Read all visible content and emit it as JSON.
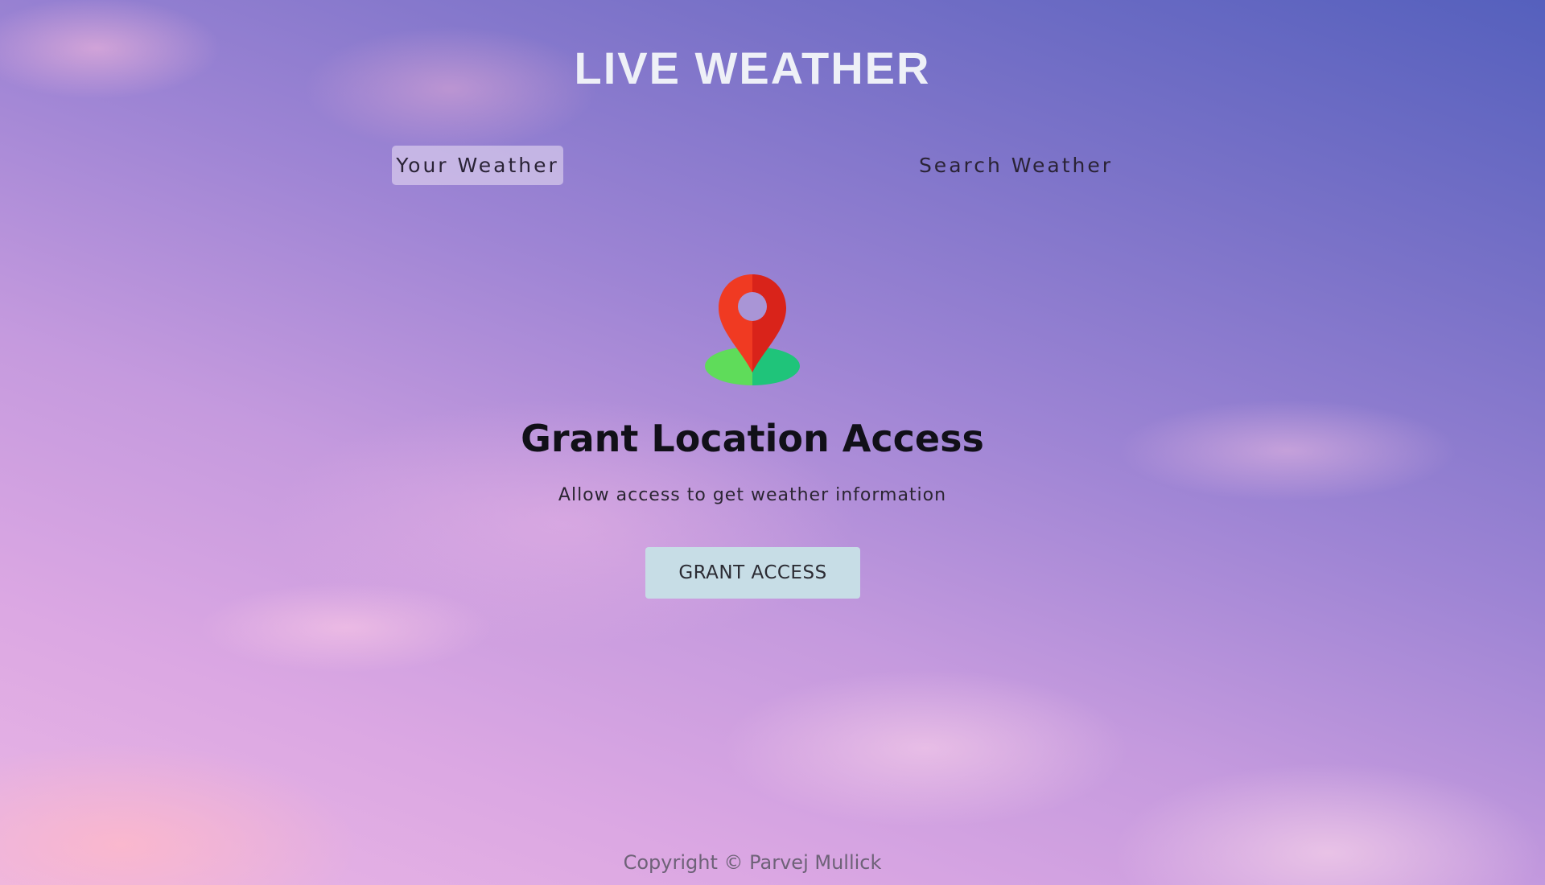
{
  "header": {
    "title": "LIVE WEATHER"
  },
  "tabs": [
    {
      "label": "Your Weather",
      "active": true
    },
    {
      "label": "Search Weather",
      "active": false
    }
  ],
  "grant": {
    "icon": "location-pin-icon",
    "heading": "Grant Location Access",
    "subtext": "Allow access to get weather information",
    "button_label": "GRANT ACCESS"
  },
  "footer": {
    "copyright": "Copyright © Parvej Mullick"
  },
  "colors": {
    "pin_red": "#f03a22",
    "pin_red_dark": "#d9231a",
    "pin_base_green": "#5fdc5a",
    "pin_base_teal": "#1fc47a",
    "button_bg": "#c7dde6",
    "title_text": "#eef0f7"
  }
}
